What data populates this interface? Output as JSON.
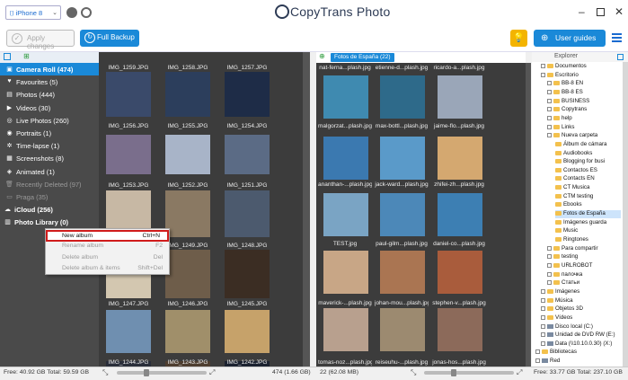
{
  "app": {
    "title": "CopyTrans Photo"
  },
  "device": {
    "selected": "iPhone 8"
  },
  "toolbar": {
    "apply_label": "Apply changes",
    "backup_label": "Full Backup",
    "guides_label": "User guides"
  },
  "sidebar": {
    "items": [
      {
        "label": "Camera Roll (474)",
        "icon": "camera-icon"
      },
      {
        "label": "Favourites (5)",
        "icon": "heart-icon"
      },
      {
        "label": "Photos (444)",
        "icon": "image-icon"
      },
      {
        "label": "Videos (30)",
        "icon": "video-icon"
      },
      {
        "label": "Live Photos (260)",
        "icon": "live-photo-icon"
      },
      {
        "label": "Portraits (1)",
        "icon": "portrait-icon"
      },
      {
        "label": "Time-lapse (1)",
        "icon": "timelapse-icon"
      },
      {
        "label": "Screenshots (8)",
        "icon": "screenshot-icon"
      },
      {
        "label": "Animated (1)",
        "icon": "animated-icon"
      },
      {
        "label": "Recently Deleted (97)",
        "icon": "trash-icon"
      },
      {
        "label": "Praga (35)",
        "icon": "album-icon"
      },
      {
        "label": "iCloud (256)",
        "icon": "cloud-icon"
      },
      {
        "label": "Photo Library (0)",
        "icon": "library-icon"
      }
    ]
  },
  "photos": {
    "labels": [
      "IMG_1259.JPG",
      "IMG_1258.JPG",
      "IMG_1257.JPG",
      "IMG_1256.JPG",
      "IMG_1255.JPG",
      "IMG_1254.JPG",
      "IMG_1253.JPG",
      "IMG_1252.JPG",
      "IMG_1251.JPG",
      "IMG_1250.JPG",
      "IMG_1249.JPG",
      "IMG_1248.JPG",
      "IMG_1247.JPG",
      "IMG_1246.JPG",
      "IMG_1245.JPG",
      "IMG_1244.JPG",
      "IMG_1243.JPG",
      "IMG_1242.JPG"
    ],
    "colors": [
      "#3a4a6a",
      "#2c3e5c",
      "#1e2c47",
      "#7a6e8c",
      "#a8b4c8",
      "#5b6b85",
      "#c7b8a4",
      "#8a7963",
      "#4c5a6e",
      "#d3c7b0",
      "#6e5d4a",
      "#3b2d23",
      "#6f8fb0",
      "#a08f6a",
      "#c6a26a",
      "#2a2e3a",
      "#4e3e30",
      "#1b2230"
    ]
  },
  "album": {
    "tag": "Fotos de España (22)"
  },
  "spain_photos": {
    "top_labels": [
      "nat-ferna...plash.jpg",
      "etienne-d...plash.jpg",
      "ricardo-a...plash.jpg"
    ],
    "labels": [
      "malgorzat...plash.jpg",
      "max-bottl...plash.jpg",
      "jaime-flo...plash.jpg",
      "ananthan-...plash.jpg",
      "jack-ward...plash.jpg",
      "zhifei-zh...plash.jpg",
      "TEST.jpg",
      "paul-gilm...plash.jpg",
      "daniel-co...plash.jpg",
      "maverick-...plash.jpg",
      "johan-mou...plash.jpg",
      "stephen-v...plash.jpg",
      "tomas-noz...plash.jpg",
      "reiseuhu-...plash.jpg",
      "jonas-hos...plash.jpg"
    ],
    "colors": [
      "#3f8ab0",
      "#2e6a8a",
      "#9aa6b8",
      "#3b79b0",
      "#5a9ac9",
      "#d4a870",
      "#7aa4c4",
      "#4c88b8",
      "#3d7fb3",
      "#c8a686",
      "#aa7552",
      "#a95c3c",
      "#b8a08e",
      "#9c8a70",
      "#8c6a5a"
    ]
  },
  "explorer": {
    "label": "Explorer",
    "items": [
      {
        "label": "Documentos",
        "indent": 1,
        "type": "folder"
      },
      {
        "label": "Escritorio",
        "indent": 1,
        "type": "folder"
      },
      {
        "label": "BB-8 EN",
        "indent": 2,
        "type": "folder"
      },
      {
        "label": "BB-8 ES",
        "indent": 2,
        "type": "folder"
      },
      {
        "label": "BUSINESS",
        "indent": 2,
        "type": "folder"
      },
      {
        "label": "Copytrans",
        "indent": 2,
        "type": "folder"
      },
      {
        "label": "help",
        "indent": 2,
        "type": "folder"
      },
      {
        "label": "Links",
        "indent": 2,
        "type": "folder"
      },
      {
        "label": "Nueva carpeta",
        "indent": 2,
        "type": "folder"
      },
      {
        "label": "Álbum de cámara",
        "indent": 3,
        "type": "folder"
      },
      {
        "label": "Audiobooks",
        "indent": 3,
        "type": "folder"
      },
      {
        "label": "Blogging for busi",
        "indent": 3,
        "type": "folder"
      },
      {
        "label": "Contactos ES",
        "indent": 3,
        "type": "folder"
      },
      {
        "label": "Contacts EN",
        "indent": 3,
        "type": "folder"
      },
      {
        "label": "CT Musica",
        "indent": 3,
        "type": "folder"
      },
      {
        "label": "CTM testing",
        "indent": 3,
        "type": "folder"
      },
      {
        "label": "Ebooks",
        "indent": 3,
        "type": "folder"
      },
      {
        "label": "Fotos de España",
        "indent": 3,
        "type": "folder",
        "selected": true
      },
      {
        "label": "Imágenes guarda",
        "indent": 3,
        "type": "folder"
      },
      {
        "label": "Music",
        "indent": 3,
        "type": "folder"
      },
      {
        "label": "Ringtones",
        "indent": 3,
        "type": "folder"
      },
      {
        "label": "Para compartir",
        "indent": 2,
        "type": "folder"
      },
      {
        "label": "testing",
        "indent": 2,
        "type": "folder"
      },
      {
        "label": "URLROBOT",
        "indent": 2,
        "type": "folder"
      },
      {
        "label": "палочка",
        "indent": 2,
        "type": "folder"
      },
      {
        "label": "Статьи",
        "indent": 2,
        "type": "folder"
      },
      {
        "label": "Imágenes",
        "indent": 1,
        "type": "folder"
      },
      {
        "label": "Música",
        "indent": 1,
        "type": "folder"
      },
      {
        "label": "Objetos 3D",
        "indent": 1,
        "type": "folder"
      },
      {
        "label": "Vídeos",
        "indent": 1,
        "type": "folder"
      },
      {
        "label": "Disco local (C:)",
        "indent": 1,
        "type": "drive"
      },
      {
        "label": "Unidad de DVD RW (E:)",
        "indent": 1,
        "type": "drive"
      },
      {
        "label": "Data (\\\\10.10.0.30) (X:)",
        "indent": 1,
        "type": "drive"
      },
      {
        "label": "Bibliotecas",
        "indent": 0,
        "type": "folder"
      },
      {
        "label": "Red",
        "indent": 0,
        "type": "drive"
      }
    ]
  },
  "context_menu": {
    "items": [
      {
        "label": "New album",
        "shortcut": "Ctrl+N",
        "enabled": true
      },
      {
        "label": "Rename album",
        "shortcut": "F2",
        "enabled": false
      },
      {
        "label": "Delete album",
        "shortcut": "Del",
        "enabled": false
      },
      {
        "label": "Delete album & items",
        "shortcut": "Shift+Del",
        "enabled": false
      }
    ]
  },
  "status": {
    "left": "Free: 40.92 GB Total: 59.59 GB",
    "photos_count": "474 (1.66 GB)",
    "album_count": "22 (62.08 MB)",
    "right": "Free: 33.77 GB Total: 237.10 GB"
  }
}
